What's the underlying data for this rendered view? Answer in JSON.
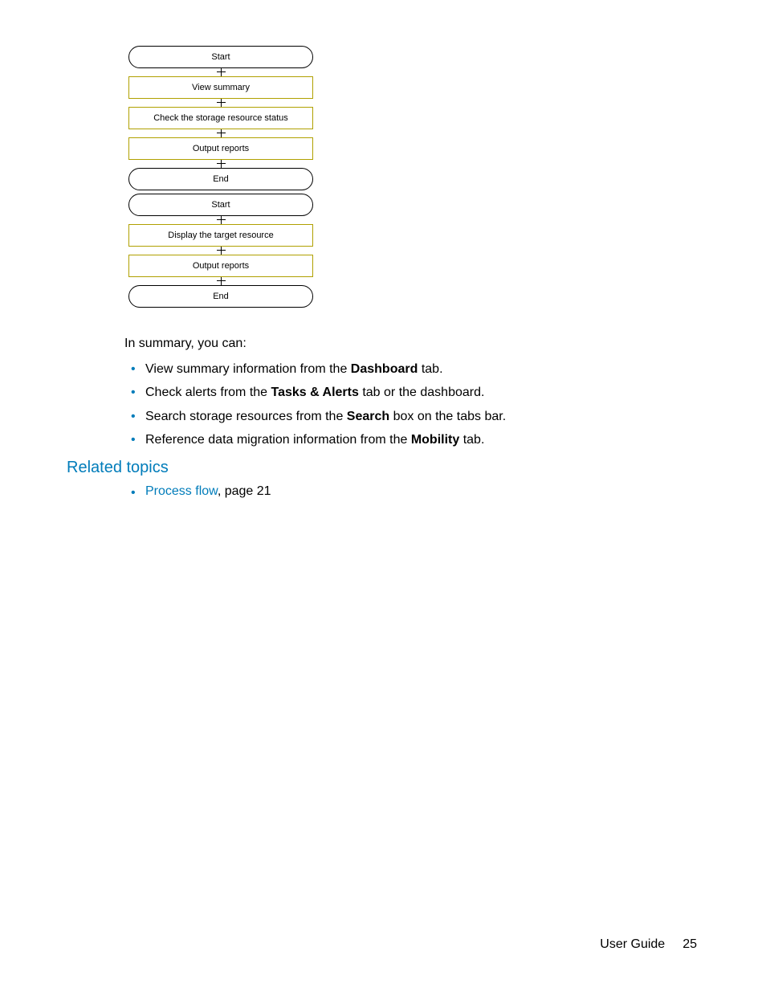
{
  "flowchart": {
    "steps": [
      {
        "label": "Start",
        "type": "terminal"
      },
      {
        "label": "View summary",
        "type": "process"
      },
      {
        "label": "Check the storage resource status",
        "type": "process"
      },
      {
        "label": "Output reports",
        "type": "process"
      },
      {
        "label": "End",
        "type": "terminal"
      },
      {
        "label": "Start",
        "type": "terminal"
      },
      {
        "label": "Display the target resource",
        "type": "process"
      },
      {
        "label": "Output reports",
        "type": "process"
      },
      {
        "label": "End",
        "type": "terminal"
      }
    ]
  },
  "intro": "In summary, you can:",
  "bullets": [
    {
      "pre": "View summary information from the ",
      "bold": "Dashboard",
      "post": " tab."
    },
    {
      "pre": "Check alerts from the ",
      "bold": "Tasks & Alerts",
      "post": " tab or the dashboard."
    },
    {
      "pre": "Search storage resources from the ",
      "bold": "Search",
      "post": " box on the tabs bar."
    },
    {
      "pre": "Reference data migration information from the ",
      "bold": "Mobility",
      "post": " tab."
    }
  ],
  "related": {
    "heading": "Related topics",
    "items": [
      {
        "link": "Process flow",
        "post": ", page 21"
      }
    ]
  },
  "footer": {
    "doc": "User Guide",
    "page": "25"
  }
}
